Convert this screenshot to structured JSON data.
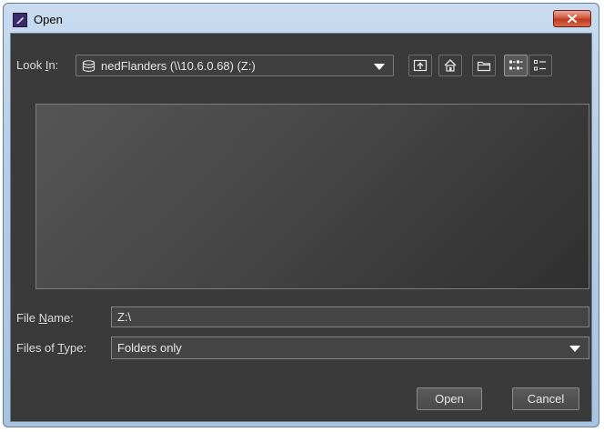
{
  "window": {
    "title": "Open"
  },
  "look_in": {
    "label_pre": "Look ",
    "label_key": "I",
    "label_post": "n:",
    "value": "nedFlanders (\\\\10.6.0.68) (Z:)"
  },
  "toolbar": {
    "icons": [
      "up-one-level-icon",
      "home-icon",
      "new-folder-icon",
      "list-view-icon",
      "details-view-icon"
    ],
    "selected": "list-view-icon"
  },
  "file_name": {
    "label_pre": "File ",
    "label_key": "N",
    "label_post": "ame:",
    "value": "Z:\\"
  },
  "files_of_type": {
    "label_pre": "Files of ",
    "label_key": "T",
    "label_post": "ype:",
    "value": "Folders only"
  },
  "buttons": {
    "open": "Open",
    "cancel": "Cancel"
  },
  "colors": {
    "background": "#3a3a3a",
    "text": "#dcdcdc",
    "field": "#444444",
    "close": "#c03a1f"
  }
}
